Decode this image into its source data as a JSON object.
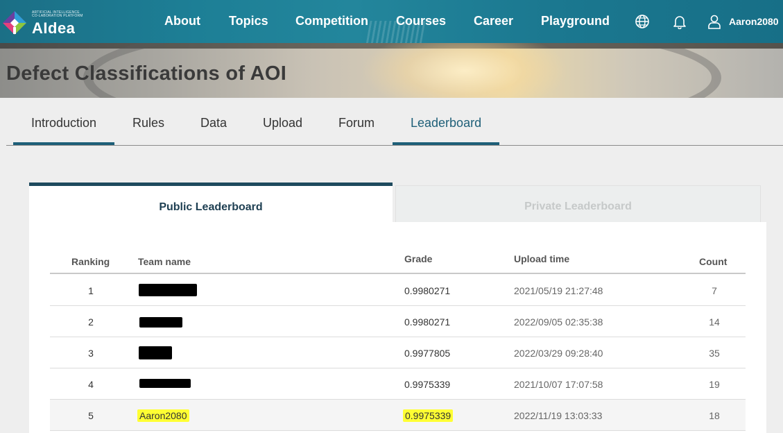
{
  "header": {
    "logo_subtext_line1": "ARTIFICIAL INTELLIGENCE",
    "logo_subtext_line2": "CO-LABORATION PLATFORM",
    "logo_text": "AIdea",
    "nav": [
      {
        "label": "About"
      },
      {
        "label": "Topics"
      },
      {
        "label": "Competition"
      },
      {
        "label": "Courses"
      },
      {
        "label": "Career"
      },
      {
        "label": "Playground"
      }
    ],
    "icons": [
      "globe-icon",
      "bell-icon",
      "user-icon"
    ],
    "username": "Aaron2080"
  },
  "hero": {
    "title": "Defect Classifications of AOI"
  },
  "tabs": [
    {
      "label": "Introduction"
    },
    {
      "label": "Rules"
    },
    {
      "label": "Data"
    },
    {
      "label": "Upload"
    },
    {
      "label": "Forum"
    },
    {
      "label": "Leaderboard",
      "active": true
    }
  ],
  "leaderboard": {
    "public_tab": "Public Leaderboard",
    "private_tab": "Private Leaderboard",
    "columns": {
      "ranking": "Ranking",
      "team": "Team name",
      "grade": "Grade",
      "upload_time": "Upload time",
      "count": "Count"
    },
    "rows": [
      {
        "rank": "1",
        "team": "",
        "team_redacted": true,
        "grade": "0.9980271",
        "upload_time": "2021/05/19 21:27:48",
        "count": "7"
      },
      {
        "rank": "2",
        "team": "",
        "team_redacted": true,
        "grade": "0.9980271",
        "upload_time": "2022/09/05 02:35:38",
        "count": "14"
      },
      {
        "rank": "3",
        "team": "",
        "team_redacted": true,
        "grade": "0.9977805",
        "upload_time": "2022/03/29 09:28:40",
        "count": "35"
      },
      {
        "rank": "4",
        "team": "",
        "team_redacted": true,
        "grade": "0.9975339",
        "upload_time": "2021/10/07 17:07:58",
        "count": "19"
      },
      {
        "rank": "5",
        "team": "Aaron2080",
        "team_redacted": false,
        "highlighted": true,
        "grade": "0.9975339",
        "upload_time": "2022/11/19 13:03:33",
        "count": "18"
      }
    ]
  },
  "colors": {
    "header_bg": "#1d7f96",
    "accent": "#1e5f78",
    "highlight": "#ffff33"
  }
}
